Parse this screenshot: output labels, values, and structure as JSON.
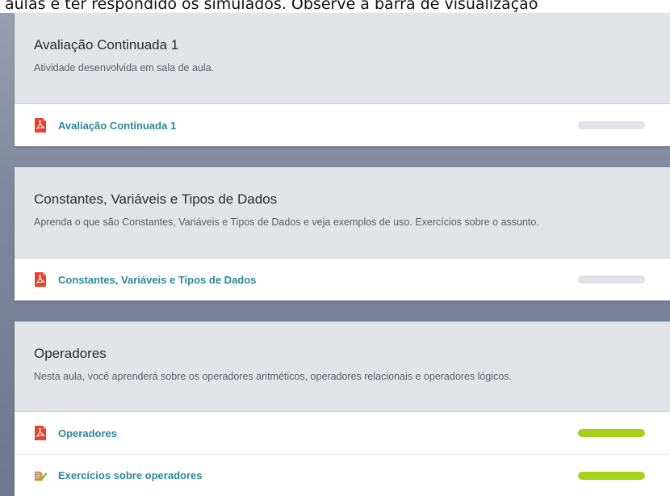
{
  "intro_text": "aulas e ter respondido os simulados. Observe a barra de visualização",
  "colors": {
    "pdf": "#e8412c",
    "link": "#2a8a98",
    "progress": "#a4d219",
    "progress_track": "#e2e3e6"
  },
  "sections": [
    {
      "title": "Avaliação Continuada 1",
      "description": "Atividade desenvolvida em sala de aula.",
      "items": [
        {
          "label": "Avaliação Continuada 1",
          "icon": "pdf-icon",
          "progress": 0
        }
      ]
    },
    {
      "title": "Constantes, Variáveis e Tipos de Dados",
      "description": "Aprenda o que são Constantes, Variáveis e Tipos de Dados e veja exemplos de uso. Exercícios sobre o assunto.",
      "items": [
        {
          "label": "Constantes, Variáveis e Tipos de Dados",
          "icon": "pdf-icon",
          "progress": 0
        }
      ]
    },
    {
      "title": "Operadores",
      "description": "Nesta aula, você aprenderá sobre os operadores aritméticos, operadores relacionais e operadores lógicos.",
      "items": [
        {
          "label": "Operadores",
          "icon": "pdf-icon",
          "progress": 1
        },
        {
          "label": "Exercícios sobre operadores",
          "icon": "exercise-edit-icon",
          "progress": 1
        }
      ]
    }
  ]
}
